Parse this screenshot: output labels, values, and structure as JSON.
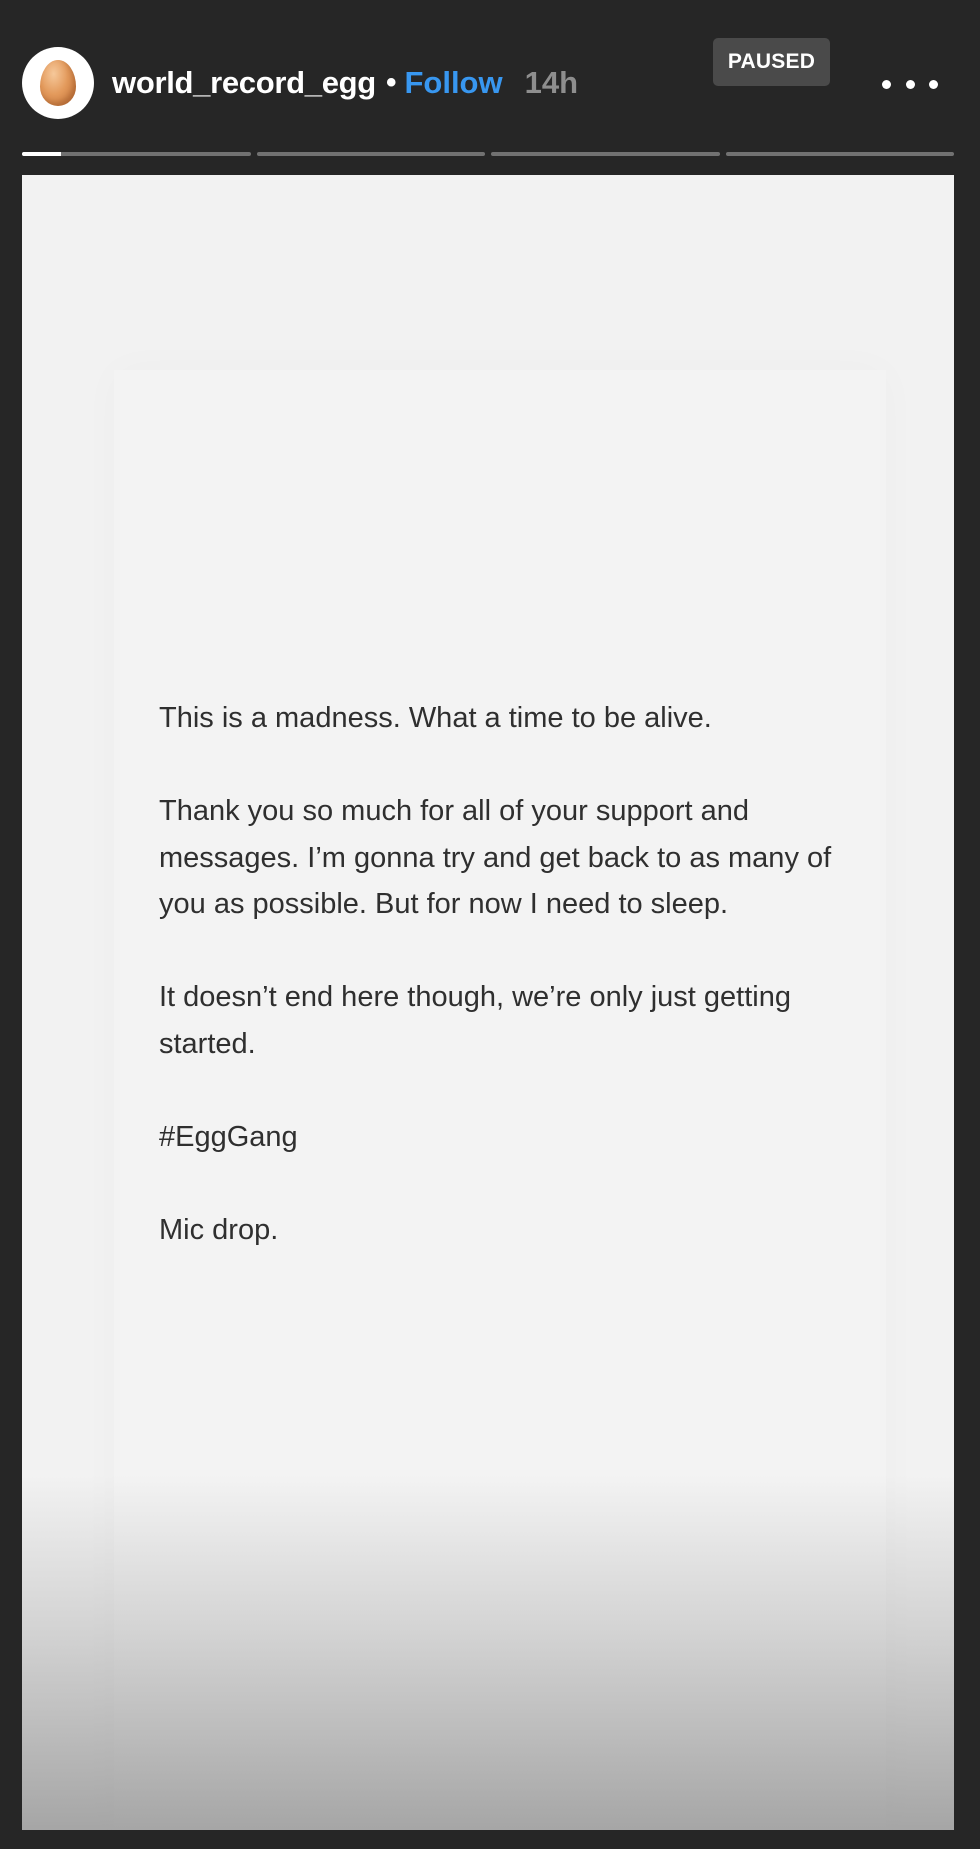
{
  "header": {
    "avatar_icon": "egg-icon",
    "username": "world_record_egg",
    "separator": "•",
    "follow_label": "Follow",
    "time_ago": "14h",
    "status_badge": "PAUSED",
    "more_icon": "more-options-icon"
  },
  "progress": {
    "segment_count": 4,
    "active_index": 0,
    "active_progress": 0.17
  },
  "story": {
    "paragraphs": [
      "This is a madness. What a time to be alive.",
      "Thank you so much for all of your support and messages. I’m gonna try and get back to as many of you as possible. But for now I need to sleep.",
      "It doesn’t end here though, we’re only just getting started.",
      "#EggGang",
      "Mic drop."
    ]
  },
  "colors": {
    "background": "#262626",
    "follow": "#3897f0",
    "time": "#8e8e8e",
    "badge": "#4a4a4a",
    "story_bg": "#f2f2f2",
    "text": "#2f2f2f"
  }
}
